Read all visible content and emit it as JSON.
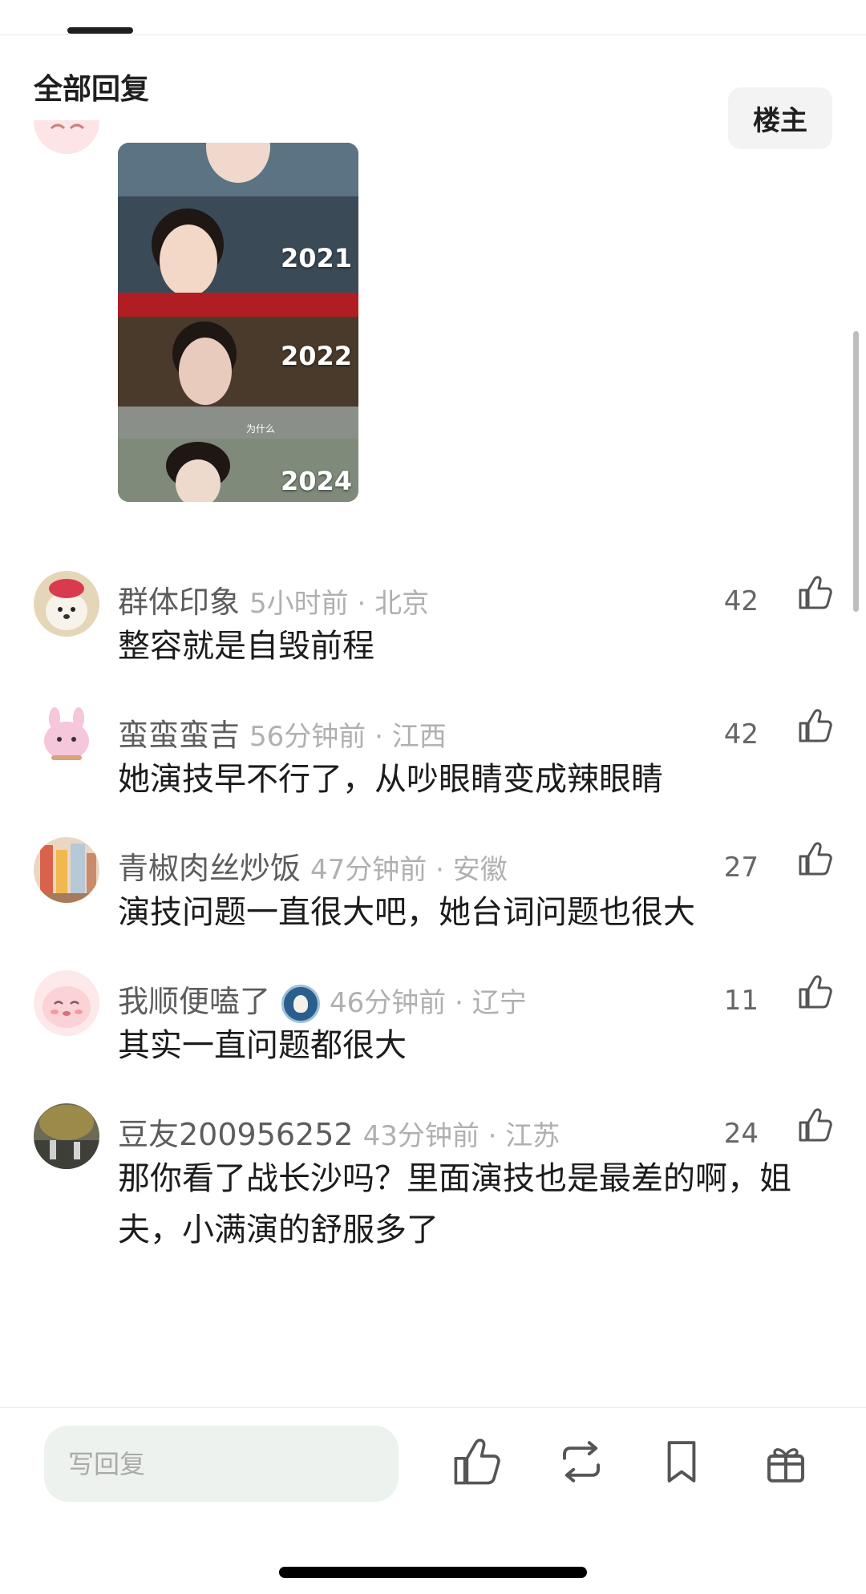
{
  "header": {
    "title": "全部回复",
    "op_button": "楼主"
  },
  "image_card": {
    "years": [
      "2021",
      "2022",
      "2024"
    ],
    "caption": "为什么"
  },
  "comments": [
    {
      "username": "群体印象",
      "meta": "5小时前 · 北京",
      "likes": "42",
      "text": "整容就是自毁前程"
    },
    {
      "username": "蛮蛮蛮吉",
      "meta": "56分钟前 · 江西",
      "likes": "42",
      "text": "她演技早不行了，从吵眼睛变成辣眼睛"
    },
    {
      "username": "青椒肉丝炒饭",
      "meta": "47分钟前 · 安徽",
      "likes": "27",
      "text": "演技问题一直很大吧，她台词问题也很大"
    },
    {
      "username": "我顺便嗑了",
      "meta": "46分钟前 · 辽宁",
      "likes": "11",
      "text": "其实一直问题都很大"
    },
    {
      "username": "豆友200956252",
      "meta": "43分钟前 · 江苏",
      "likes": "24",
      "text": "那你看了战长沙吗？里面演技也是最差的啊，姐夫，小满演的舒服多了"
    }
  ],
  "bottom_bar": {
    "reply_placeholder": "写回复"
  }
}
